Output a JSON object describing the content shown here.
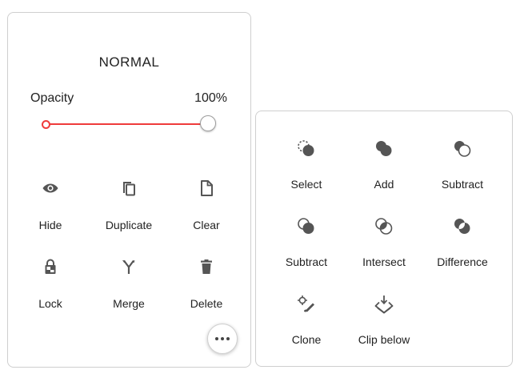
{
  "layer_panel": {
    "blend_mode": "NORMAL",
    "opacity_label": "Opacity",
    "opacity_value": "100%",
    "opacity_fraction": 1.0,
    "slider_color": "#ef3b3b",
    "actions": [
      {
        "label": "Hide",
        "icon": "eye-icon"
      },
      {
        "label": "Duplicate",
        "icon": "copy-icon"
      },
      {
        "label": "Clear",
        "icon": "file-icon"
      },
      {
        "label": "Lock",
        "icon": "lock-icon"
      },
      {
        "label": "Merge",
        "icon": "merge-icon"
      },
      {
        "label": "Delete",
        "icon": "trash-icon"
      }
    ],
    "more_icon": "more-horizontal-icon"
  },
  "mask_panel": {
    "actions": [
      {
        "label": "Select",
        "icon": "select-mask-icon"
      },
      {
        "label": "Add",
        "icon": "add-mask-icon"
      },
      {
        "label": "Subtract",
        "icon": "subtract-mask-icon"
      },
      {
        "label": "Subtract",
        "icon": "subtract-reverse-mask-icon"
      },
      {
        "label": "Intersect",
        "icon": "intersect-mask-icon"
      },
      {
        "label": "Difference",
        "icon": "difference-mask-icon"
      },
      {
        "label": "Clone",
        "icon": "clone-icon"
      },
      {
        "label": "Clip below",
        "icon": "clip-below-icon"
      }
    ]
  }
}
